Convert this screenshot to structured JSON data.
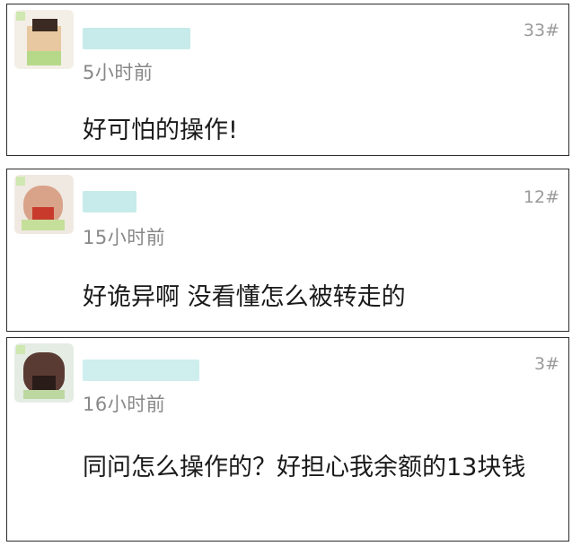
{
  "comments": [
    {
      "floor": "33#",
      "time": "5小时前",
      "content": "好可怕的操作!",
      "avatar_color": "#e7c9a2"
    },
    {
      "floor": "12#",
      "time": "15小时前",
      "content": "好诡异啊 没看懂怎么被转走的",
      "avatar_color": "#d9a38a"
    },
    {
      "floor": "3#",
      "time": "16小时前",
      "content": "同问怎么操作的？好担心我余额的13块钱",
      "avatar_color": "#5a3b33"
    }
  ],
  "colors": {
    "username_blur": "#bfe6e8",
    "border": "#2b2b2b",
    "time_text": "#888888"
  }
}
